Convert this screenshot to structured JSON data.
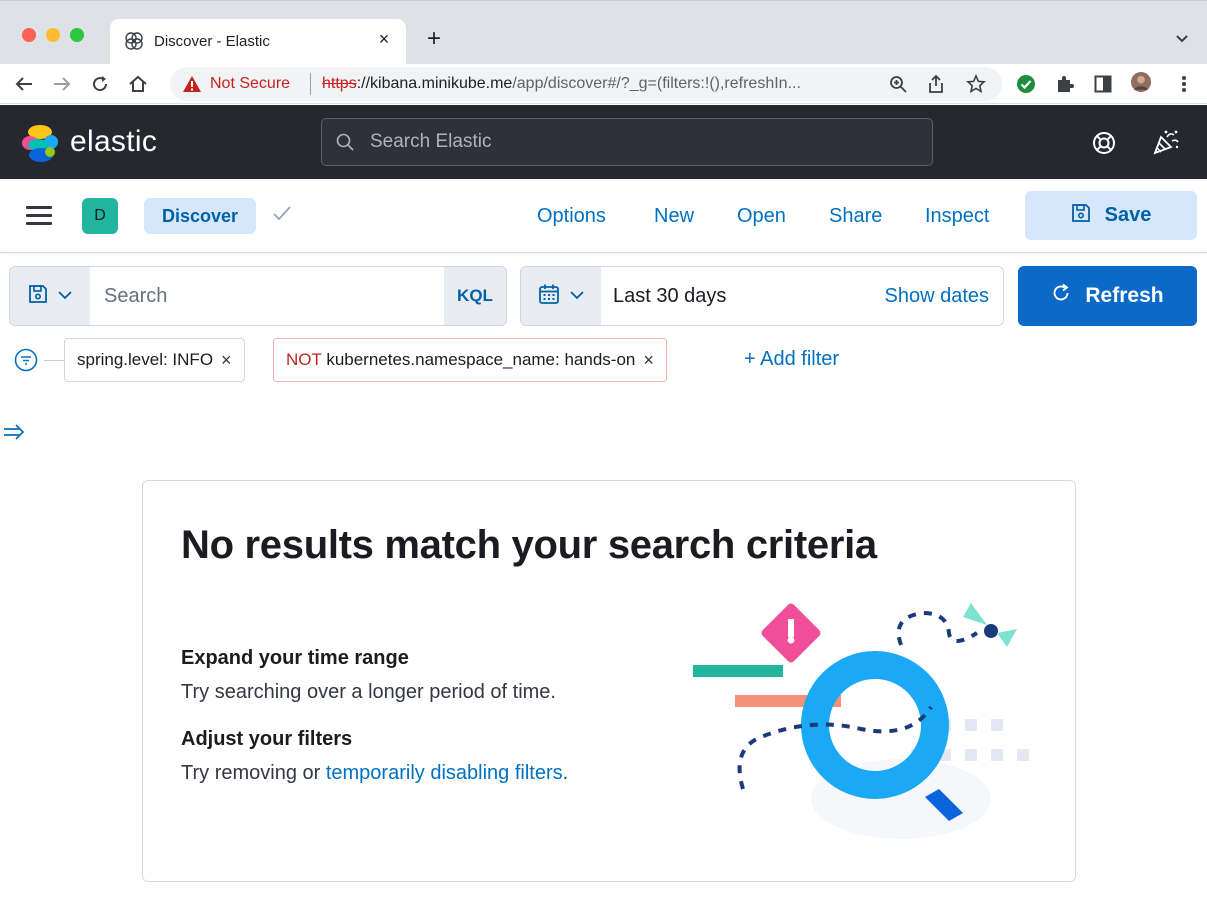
{
  "browser": {
    "tab": {
      "title": "Discover - Elastic",
      "close_glyph": "×"
    },
    "new_tab_glyph": "+",
    "address": {
      "security_label": "Not Secure",
      "url_scheme": "https",
      "url_host": "://kibana.minikube.me",
      "url_path": "/app/discover#/?_g=(filters:!(),refreshIn..."
    },
    "icons": [
      "back-icon",
      "forward-icon",
      "reload-icon",
      "home-icon",
      "warning-icon",
      "zoom-icon",
      "share-icon",
      "bookmark-star-icon",
      "extension-check-icon",
      "extensions-puzzle-icon",
      "side-panel-icon",
      "profile-avatar",
      "more-menu-icon"
    ]
  },
  "header": {
    "brand": "elastic",
    "search_placeholder": "Search Elastic"
  },
  "app_bar": {
    "space_initial": "D",
    "breadcrumb": "Discover",
    "links": {
      "options": "Options",
      "new": "New",
      "open": "Open",
      "share": "Share",
      "inspect": "Inspect"
    },
    "save_label": "Save"
  },
  "query_bar": {
    "search_placeholder": "Search",
    "language": "KQL",
    "date_range": "Last 30 days",
    "show_dates": "Show dates",
    "refresh_label": "Refresh"
  },
  "filters": {
    "items": [
      {
        "negated": false,
        "prefix": "",
        "text": "spring.level: INFO"
      },
      {
        "negated": true,
        "prefix": "NOT",
        "text": "kubernetes.namespace_name: hands-on"
      }
    ],
    "remove_glyph": "×",
    "add_label": "+ Add filter"
  },
  "empty_state": {
    "title": "No results match your search criteria",
    "tips": [
      {
        "heading": "Expand your time range",
        "body": "Try searching over a longer period of time."
      },
      {
        "heading": "Adjust your filters",
        "body_prefix": "Try removing or ",
        "link": "temporarily disabling filters",
        "body_suffix": "."
      }
    ]
  },
  "colors": {
    "kibana_header": "#25282f",
    "primary": "#0b6ac8",
    "link": "#0071c2",
    "space_badge": "#20b59c",
    "negated_filter": "#bd271e"
  }
}
